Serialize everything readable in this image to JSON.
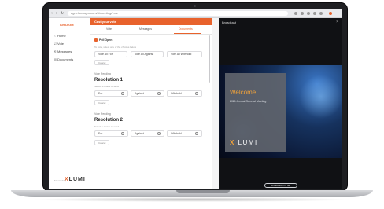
{
  "browser": {
    "url": "agm.lumiagm.com/#/meeting/vote"
  },
  "sidebar": {
    "brand": "lumiAGM",
    "items": [
      {
        "label": "Home",
        "icon": "home-icon"
      },
      {
        "label": "Vote",
        "icon": "vote-icon"
      },
      {
        "label": "Messages",
        "icon": "message-icon"
      },
      {
        "label": "Documents",
        "icon": "document-icon"
      }
    ],
    "powered_by": "Powered by",
    "logo_x": "X",
    "logo_text": "LUMI"
  },
  "panel": {
    "title": "Cast your vote",
    "tabs": [
      "Vote",
      "Messages",
      "Documents"
    ],
    "poll_label": "Poll Open",
    "poll_sub": "To vote, select one of the choices below",
    "top_options": [
      "Vote All For",
      "Vote All Against",
      "Vote All Withhold"
    ],
    "cancel_label": "Cancel",
    "resolutions": [
      {
        "status": "Vote Pending",
        "title": "Resolution 1",
        "sub": "Select a choice to send",
        "options": [
          "For",
          "Against",
          "Withhold"
        ],
        "cancel": "Cancel"
      },
      {
        "status": "Vote Pending",
        "title": "Resolution 2",
        "sub": "Select a choice to send",
        "options": [
          "For",
          "Against",
          "Withhold"
        ],
        "cancel": "Cancel"
      }
    ]
  },
  "broadcast": {
    "title": "Broadcast",
    "welcome": "Welcome",
    "meeting": "2021 Annual General Meeting",
    "logo_x": "X",
    "logo_text": "LUMI",
    "button": "Broadcast in a tab"
  }
}
